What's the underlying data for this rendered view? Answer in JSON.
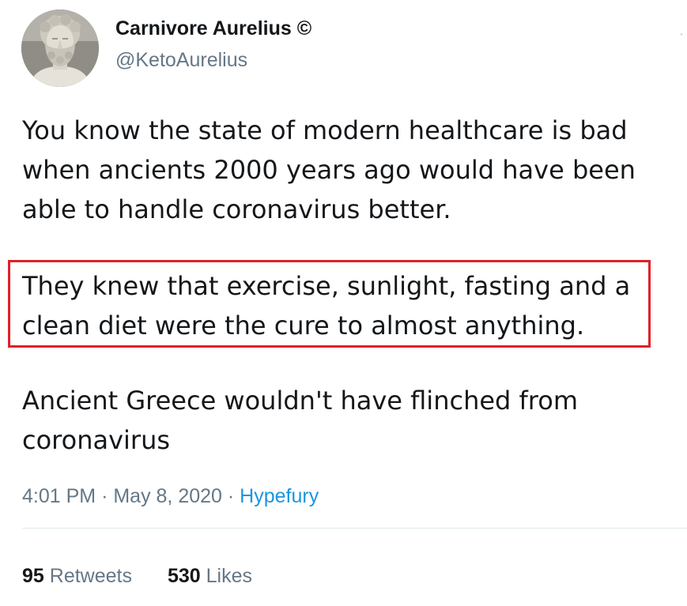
{
  "author": {
    "display_name": "Carnivore Aurelius ©",
    "handle": "@KetoAurelius",
    "avatar": "marble-bust-avatar"
  },
  "tweet": {
    "paragraphs": [
      {
        "lines": [
          "You know the state of modern healthcare is bad",
          "when ancients 2000 years ago would have been",
          "able to handle coronavirus better."
        ]
      },
      {
        "lines": [
          "They knew that exercise, sunlight, fasting and a",
          "clean diet were the cure to almost anything."
        ],
        "highlighted": true
      },
      {
        "lines": [
          "Ancient Greece wouldn't have flinched from",
          "coronavirus"
        ]
      }
    ],
    "time": "4:01 PM",
    "separator": "·",
    "date": "May 8, 2020",
    "source": "Hypefury"
  },
  "stats": {
    "retweets_count": "95",
    "retweets_label": "Retweets",
    "likes_count": "530",
    "likes_label": "Likes"
  },
  "colors": {
    "text": "#14171a",
    "secondary": "#657786",
    "link": "#1b95e0",
    "highlight_border": "#e0202a",
    "divider": "#e1e8ed"
  }
}
